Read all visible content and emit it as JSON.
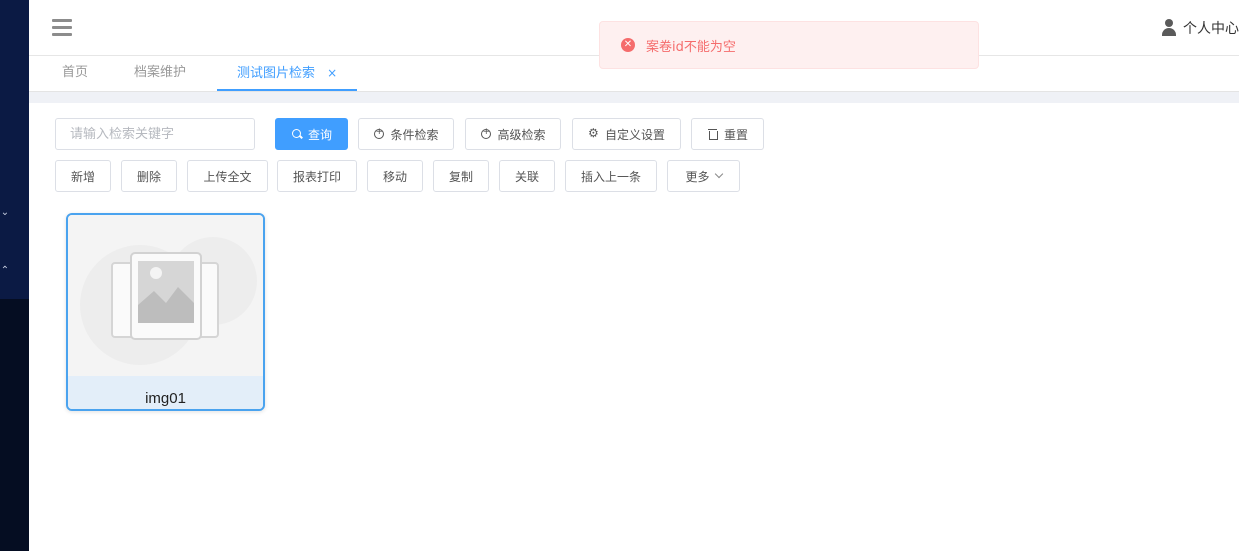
{
  "header": {
    "user_label": "个人中心"
  },
  "tabs": [
    {
      "label": "首页"
    },
    {
      "label": "档案维护"
    },
    {
      "label": "测试图片检索",
      "close": "×"
    }
  ],
  "search": {
    "placeholder": "请输入检索关键字",
    "value": ""
  },
  "toolbar_row1": {
    "query": "查询",
    "condition_search": "条件检索",
    "advanced_search": "高级检索",
    "custom_settings": "自定义设置",
    "reset": "重置"
  },
  "toolbar_row2": {
    "add": "新增",
    "delete": "删除",
    "upload_full_text": "上传全文",
    "report_print": "报表打印",
    "move": "移动",
    "copy": "复制",
    "link": "关联",
    "insert_previous": "插入上一条",
    "more": "更多"
  },
  "gallery": {
    "items": [
      {
        "name": "img01"
      }
    ]
  },
  "toast": {
    "message": "案卷id不能为空",
    "type": "error"
  },
  "colors": {
    "primary": "#409eff",
    "sidebar": "#0b1a44",
    "error": "#f56c6c",
    "card_border": "#4aa3ef"
  }
}
